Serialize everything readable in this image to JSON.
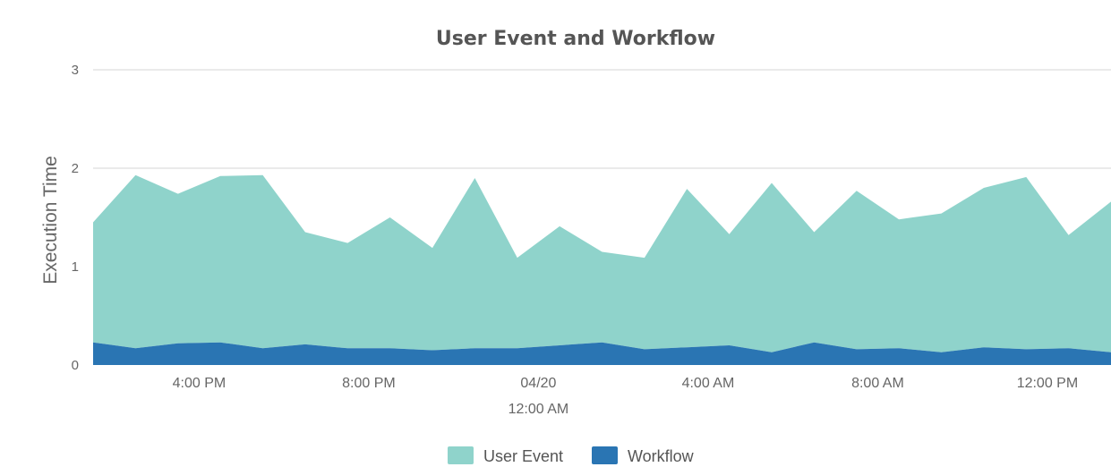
{
  "chart_data": {
    "type": "area",
    "title": "User Event and Workflow",
    "xlabel": "",
    "ylabel": "Execution Time",
    "ylim": [
      0,
      3
    ],
    "yticks": [
      "0",
      "1",
      "2",
      "3"
    ],
    "grid": true,
    "stacked": true,
    "legend_position": "bottom-center",
    "x_tick_labels": [
      {
        "label": "4:00 PM",
        "sub": "",
        "index": 2.5
      },
      {
        "label": "8:00 PM",
        "sub": "",
        "index": 6.5
      },
      {
        "label": "04/20",
        "sub": "12:00 AM",
        "index": 10.5
      },
      {
        "label": "4:00 AM",
        "sub": "",
        "index": 14.5
      },
      {
        "label": "8:00 AM",
        "sub": "",
        "index": 18.5
      },
      {
        "label": "12:00 PM",
        "sub": "",
        "index": 22.5
      }
    ],
    "series": [
      {
        "name": "Workflow",
        "color": "#2a75b3",
        "values": [
          0.23,
          0.17,
          0.22,
          0.23,
          0.17,
          0.21,
          0.17,
          0.17,
          0.15,
          0.17,
          0.17,
          0.2,
          0.23,
          0.16,
          0.18,
          0.2,
          0.13,
          0.23,
          0.16,
          0.17,
          0.13,
          0.18,
          0.16,
          0.17,
          0.13
        ]
      },
      {
        "name": "User Event",
        "color": "#8fd3cb",
        "values": [
          1.22,
          1.76,
          1.52,
          1.69,
          1.76,
          1.14,
          1.07,
          1.33,
          1.04,
          1.73,
          0.92,
          1.21,
          0.92,
          0.93,
          1.61,
          1.13,
          1.72,
          1.12,
          1.61,
          1.31,
          1.41,
          1.62,
          1.75,
          1.15,
          1.53
        ]
      }
    ]
  }
}
